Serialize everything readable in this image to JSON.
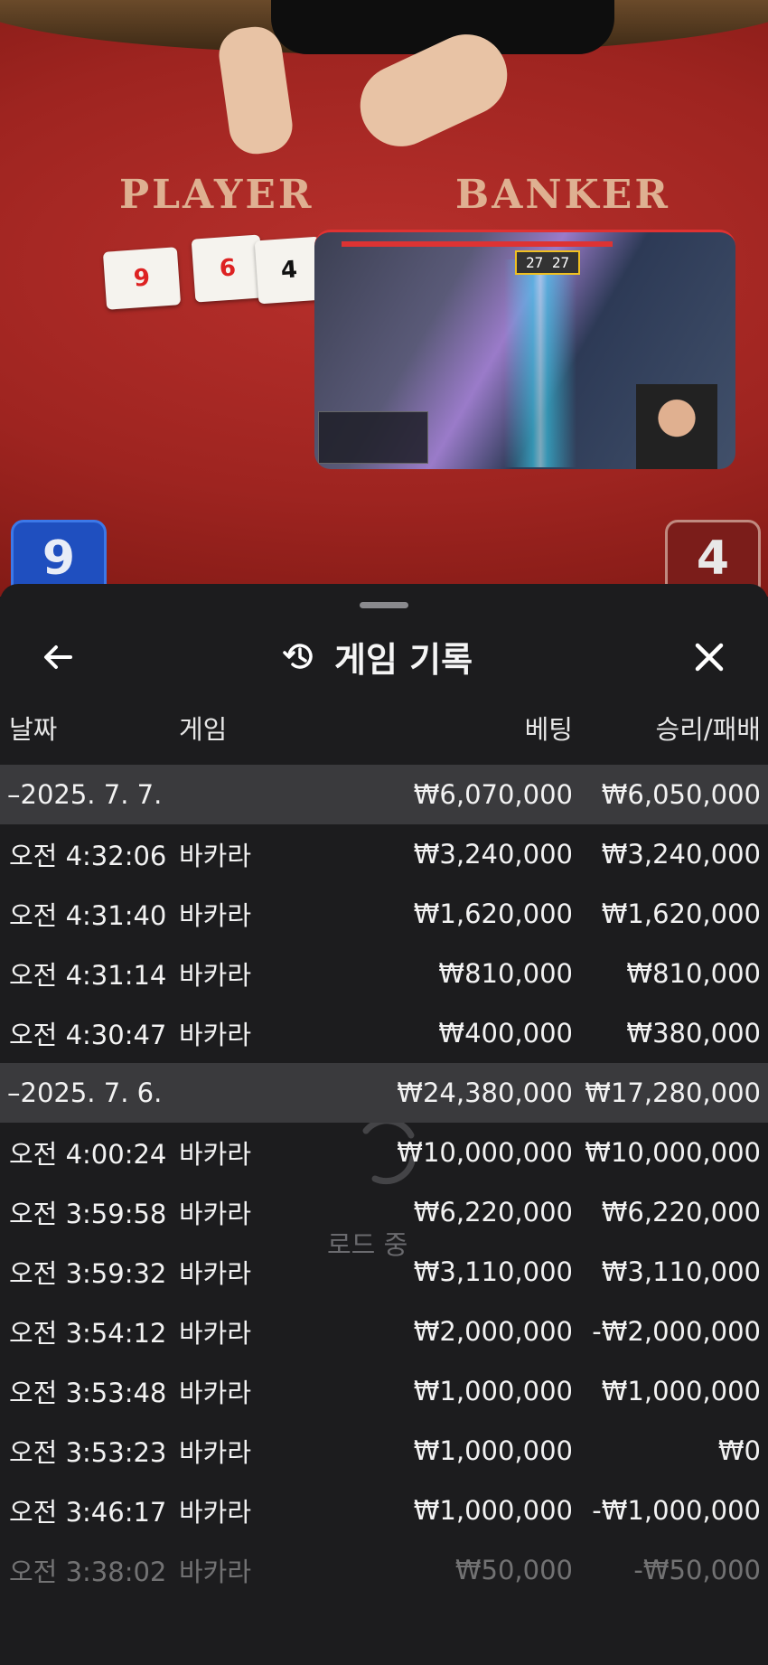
{
  "video": {
    "player_label": "PLAYER",
    "banker_label": "BANKER",
    "player_cards": [
      "9",
      "6",
      "4"
    ],
    "player_score": "9",
    "banker_score": "4",
    "pip_timer": "27 27"
  },
  "sheet": {
    "title": "게임 기록",
    "back_icon": "arrow-left-icon",
    "history_icon": "history-icon",
    "close_icon": "close-icon",
    "columns": {
      "date": "날짜",
      "game": "게임",
      "bet": "베팅",
      "winloss": "승리/패배"
    },
    "loading_text": "로드 중"
  },
  "rows": [
    {
      "type": "date",
      "time": "–2025. 7. 7.",
      "game": "",
      "bet": "₩6,070,000",
      "winloss": "₩6,050,000"
    },
    {
      "type": "entry",
      "time": "오전 4:32:06",
      "game": "바카라",
      "bet": "₩3,240,000",
      "winloss": "₩3,240,000"
    },
    {
      "type": "entry",
      "time": "오전 4:31:40",
      "game": "바카라",
      "bet": "₩1,620,000",
      "winloss": "₩1,620,000"
    },
    {
      "type": "entry",
      "time": "오전 4:31:14",
      "game": "바카라",
      "bet": "₩810,000",
      "winloss": "₩810,000"
    },
    {
      "type": "entry",
      "time": "오전 4:30:47",
      "game": "바카라",
      "bet": "₩400,000",
      "winloss": "₩380,000"
    },
    {
      "type": "date",
      "time": "–2025. 7. 6.",
      "game": "",
      "bet": "₩24,380,000",
      "winloss": "₩17,280,000"
    },
    {
      "type": "entry",
      "time": "오전 4:00:24",
      "game": "바카라",
      "bet": "₩10,000,000",
      "winloss": "₩10,000,000"
    },
    {
      "type": "entry",
      "time": "오전 3:59:58",
      "game": "바카라",
      "bet": "₩6,220,000",
      "winloss": "₩6,220,000"
    },
    {
      "type": "entry",
      "time": "오전 3:59:32",
      "game": "바카라",
      "bet": "₩3,110,000",
      "winloss": "₩3,110,000"
    },
    {
      "type": "entry",
      "time": "오전 3:54:12",
      "game": "바카라",
      "bet": "₩2,000,000",
      "winloss": "-₩2,000,000"
    },
    {
      "type": "entry",
      "time": "오전 3:53:48",
      "game": "바카라",
      "bet": "₩1,000,000",
      "winloss": "₩1,000,000"
    },
    {
      "type": "entry",
      "time": "오전 3:53:23",
      "game": "바카라",
      "bet": "₩1,000,000",
      "winloss": "₩0"
    },
    {
      "type": "entry",
      "time": "오전 3:46:17",
      "game": "바카라",
      "bet": "₩1,000,000",
      "winloss": "-₩1,000,000"
    },
    {
      "type": "faded",
      "time": "오전 3:38:02",
      "game": "바카라",
      "bet": "₩50,000",
      "winloss": "-₩50,000"
    }
  ]
}
